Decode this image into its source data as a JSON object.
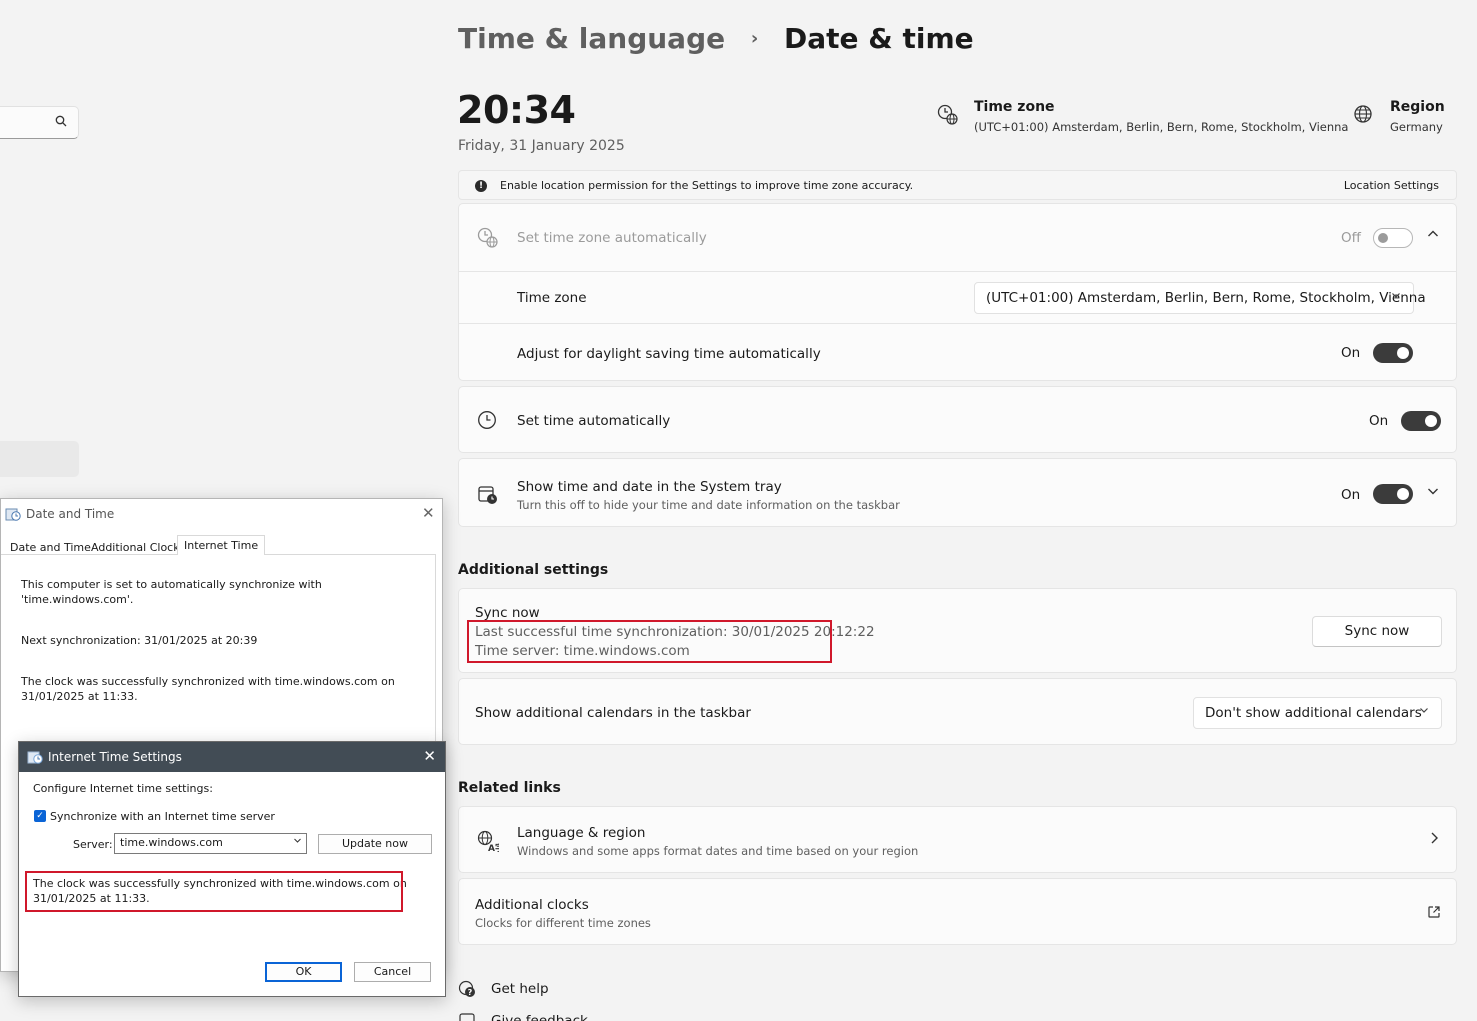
{
  "nav": {
    "search_icon": "search-icon"
  },
  "header": {
    "breadcrumb_parent": "Time & language",
    "breadcrumb_separator": "›",
    "breadcrumb_current": "Date & time"
  },
  "summary": {
    "time": "20:34",
    "date": "Friday, 31 January 2025",
    "timezone_title": "Time zone",
    "timezone_value": "(UTC+01:00) Amsterdam, Berlin, Bern, Rome, Stockholm, Vienna",
    "region_title": "Region",
    "region_value": "Germany"
  },
  "infobar": {
    "badge": "!",
    "text": "Enable location permission for the Settings to improve time zone accuracy.",
    "link": "Location Settings"
  },
  "timezone_card": {
    "auto_label": "Set time zone automatically",
    "auto_state": "Off",
    "auto_value": false,
    "expand_chevron": "⌃",
    "timezone_label": "Time zone",
    "timezone_selected": "(UTC+01:00) Amsterdam, Berlin, Bern, Rome, Stockholm, Vienna",
    "dst_label": "Adjust for daylight saving time automatically",
    "dst_state": "On",
    "dst_value": true
  },
  "set_time_auto": {
    "label": "Set time automatically",
    "state": "On",
    "value": true
  },
  "system_tray": {
    "label": "Show time and date in the System tray",
    "sublabel": "Turn this off to hide your time and date information on the taskbar",
    "state": "On",
    "value": true,
    "chevron": "⌄"
  },
  "additional_settings": {
    "title": "Additional settings",
    "sync_title": "Sync now",
    "last_sync": "Last successful time synchronization: 30/01/2025 20:12:22",
    "time_server": "Time server: time.windows.com",
    "sync_button": "Sync now",
    "calendars_label": "Show additional calendars in the taskbar",
    "calendars_selected": "Don't show additional calendars"
  },
  "related_links": {
    "title": "Related links",
    "language_title": "Language & region",
    "language_sub": "Windows and some apps format dates and time based on your region",
    "language_chevron": "›",
    "clocks_title": "Additional clocks",
    "clocks_sub": "Clocks for different time zones",
    "clocks_link_icon": "↗"
  },
  "help": {
    "get_help": "Get help",
    "give_feedback": "Give feedback"
  },
  "date_time_dialog": {
    "title": "Date and Time",
    "close": "✕",
    "tabs": [
      "Date and Time",
      "Additional Clocks",
      "Internet Time"
    ],
    "active_tab": "Internet Time",
    "line1": "This computer is set to automatically synchronize with",
    "line1b": "'time.windows.com'.",
    "next_sync": "Next synchronization: 31/01/2025 at 20:39",
    "success1": "The clock was successfully synchronized with time.windows.com on",
    "success1b": "31/01/2025 at 11:33."
  },
  "internet_time_dialog": {
    "title": "Internet Time Settings",
    "close": "✕",
    "configure": "Configure Internet time settings:",
    "sync_checkbox_label": "Synchronize with an Internet time server",
    "sync_checked": true,
    "server_label": "Server:",
    "server_value": "time.windows.com",
    "update_button": "Update now",
    "success1": "The clock was successfully synchronized with time.windows.com on",
    "success1b": "31/01/2025 at 11:33.",
    "ok_button": "OK",
    "cancel_button": "Cancel"
  },
  "colors": {
    "highlight": "#d0182b",
    "toggle_on": "#3b3b3b",
    "checkbox": "#0a64d6",
    "titlebar": "#424c55"
  }
}
